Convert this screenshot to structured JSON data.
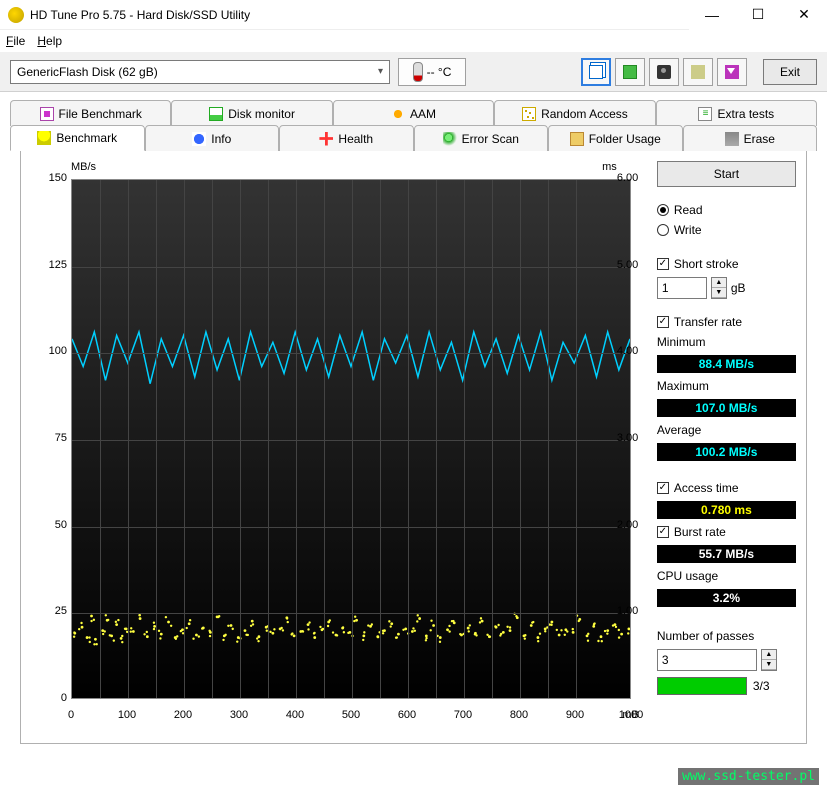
{
  "window": {
    "title": "HD Tune Pro 5.75 - Hard Disk/SSD Utility"
  },
  "menu": {
    "file": "File",
    "help": "Help"
  },
  "toolbar": {
    "device": "GenericFlash Disk (62 gB)",
    "temp": "-- °C",
    "exit": "Exit"
  },
  "tabs_row1": {
    "file_benchmark": "File Benchmark",
    "disk_monitor": "Disk monitor",
    "aam": "AAM",
    "random_access": "Random Access",
    "extra_tests": "Extra tests"
  },
  "tabs_row2": {
    "benchmark": "Benchmark",
    "info": "Info",
    "health": "Health",
    "error_scan": "Error Scan",
    "folder_usage": "Folder Usage",
    "erase": "Erase"
  },
  "side": {
    "start": "Start",
    "read": "Read",
    "write": "Write",
    "short_stroke": "Short stroke",
    "short_stroke_val": "1",
    "short_stroke_unit": "gB",
    "transfer_rate": "Transfer rate",
    "minimum": "Minimum",
    "minimum_val": "88.4 MB/s",
    "maximum": "Maximum",
    "maximum_val": "107.0 MB/s",
    "average": "Average",
    "average_val": "100.2 MB/s",
    "access_time": "Access time",
    "access_time_val": "0.780 ms",
    "burst_rate": "Burst rate",
    "burst_rate_val": "55.7 MB/s",
    "cpu_usage": "CPU usage",
    "cpu_usage_val": "3.2%",
    "num_passes": "Number of passes",
    "num_passes_val": "3",
    "progress": "3/3"
  },
  "chart_axes": {
    "yleft_label": "MB/s",
    "yright_label": "ms",
    "x_unit": "mB",
    "yleft_ticks": [
      "150",
      "125",
      "100",
      "75",
      "50",
      "25",
      "0"
    ],
    "yright_ticks": [
      "6.00",
      "5.00",
      "4.00",
      "3.00",
      "2.00",
      "1.00",
      ""
    ],
    "x_ticks": [
      "0",
      "100",
      "200",
      "300",
      "400",
      "500",
      "600",
      "700",
      "800",
      "900",
      "1000"
    ]
  },
  "chart_data": {
    "type": "line",
    "title": "",
    "xlabel": "mB",
    "ylabel_left": "MB/s",
    "ylabel_right": "ms",
    "xlim": [
      0,
      1000
    ],
    "ylim_left": [
      0,
      150
    ],
    "ylim_right": [
      0,
      6.0
    ],
    "series": [
      {
        "name": "Transfer rate (MB/s)",
        "axis": "left",
        "color": "#00d0ff",
        "x": [
          0,
          20,
          40,
          60,
          80,
          100,
          120,
          140,
          160,
          180,
          200,
          220,
          240,
          260,
          280,
          300,
          320,
          340,
          360,
          380,
          400,
          420,
          440,
          460,
          480,
          500,
          520,
          540,
          560,
          580,
          600,
          620,
          640,
          660,
          680,
          700,
          720,
          740,
          760,
          780,
          800,
          820,
          840,
          860,
          880,
          900,
          920,
          940,
          960,
          980,
          1000
        ],
        "values": [
          104,
          96,
          106,
          92,
          105,
          97,
          106,
          91,
          104,
          96,
          105,
          93,
          106,
          95,
          104,
          92,
          106,
          96,
          103,
          94,
          106,
          95,
          104,
          93,
          105,
          96,
          106,
          92,
          104,
          97,
          105,
          93,
          106,
          95,
          103,
          92,
          106,
          96,
          104,
          94,
          105,
          95,
          106,
          92,
          103,
          97,
          105,
          93,
          106,
          95,
          104
        ]
      },
      {
        "name": "Access time (ms)",
        "axis": "right",
        "type": "scatter",
        "color": "#ffff40",
        "x": [
          5,
          18,
          27,
          35,
          42,
          55,
          63,
          71,
          80,
          88,
          97,
          110,
          122,
          135,
          148,
          160,
          173,
          185,
          198,
          210,
          223,
          235,
          248,
          260,
          273,
          285,
          298,
          310,
          323,
          335,
          348,
          360,
          373,
          385,
          398,
          410,
          423,
          435,
          448,
          460,
          473,
          485,
          498,
          510,
          523,
          535,
          548,
          560,
          573,
          585,
          598,
          610,
          623,
          635,
          648,
          660,
          673,
          685,
          698,
          710,
          723,
          735,
          748,
          760,
          773,
          785,
          798,
          810,
          823,
          835,
          848,
          860,
          873,
          885,
          898,
          910,
          923,
          935,
          948,
          960,
          973,
          985,
          998
        ],
        "values": [
          0.75,
          0.82,
          0.7,
          0.95,
          0.68,
          0.78,
          0.9,
          0.72,
          0.85,
          0.69,
          0.8,
          0.77,
          0.92,
          0.71,
          0.83,
          0.74,
          0.88,
          0.7,
          0.79,
          0.86,
          0.73,
          0.81,
          0.76,
          0.94,
          0.72,
          0.84,
          0.7,
          0.78,
          0.89,
          0.71,
          0.82,
          0.75,
          0.8,
          0.93,
          0.72,
          0.77,
          0.85,
          0.7,
          0.79,
          0.88,
          0.73,
          0.81,
          0.76,
          0.9,
          0.72,
          0.83,
          0.71,
          0.78,
          0.86,
          0.74,
          0.8,
          0.77,
          0.92,
          0.72,
          0.84,
          0.7,
          0.79,
          0.87,
          0.73,
          0.81,
          0.75,
          0.89,
          0.71,
          0.82,
          0.76,
          0.78,
          0.93,
          0.72,
          0.84,
          0.7,
          0.8,
          0.88,
          0.73,
          0.79,
          0.76,
          0.91,
          0.72,
          0.83,
          0.71,
          0.78,
          0.85,
          0.74,
          0.8
        ]
      }
    ]
  },
  "watermark": "www.ssd-tester.pl"
}
